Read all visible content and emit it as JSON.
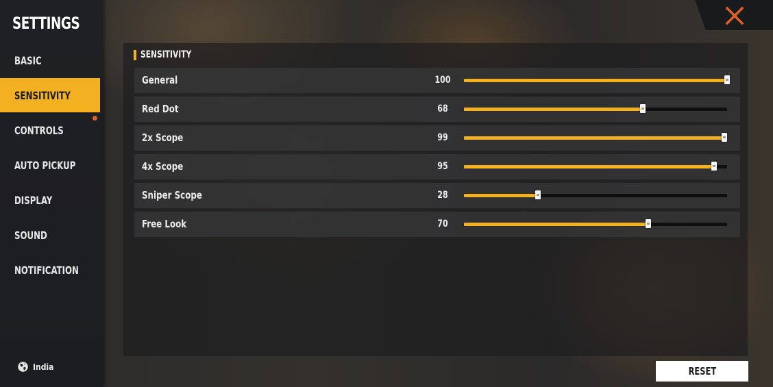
{
  "app": {
    "title": "SETTINGS"
  },
  "sidebar": {
    "items": [
      {
        "label": "BASIC"
      },
      {
        "label": "SENSITIVITY"
      },
      {
        "label": "CONTROLS"
      },
      {
        "label": "AUTO PICKUP"
      },
      {
        "label": "DISPLAY"
      },
      {
        "label": "SOUND"
      },
      {
        "label": "NOTIFICATION"
      }
    ],
    "active": "SENSITIVITY",
    "region": "India",
    "region_icon": "globe-icon"
  },
  "section": {
    "title": "SENSITIVITY"
  },
  "sensitivity": [
    {
      "label": "General",
      "value": "100",
      "level": 100
    },
    {
      "label": "Red Dot",
      "value": "68",
      "level": 68
    },
    {
      "label": "2x Scope",
      "value": "99",
      "level": 99
    },
    {
      "label": "4x Scope",
      "value": "95",
      "level": 95
    },
    {
      "label": "Sniper Scope",
      "value": "28",
      "level": 28
    },
    {
      "label": "Free Look",
      "value": "70",
      "level": 70
    }
  ],
  "slider_max": 100,
  "buttons": {
    "reset_label": "RESET",
    "close_icon": "close-icon"
  },
  "colors": {
    "accent": "#f3b020",
    "close": "#e0602a",
    "track": "#0f0f10"
  }
}
